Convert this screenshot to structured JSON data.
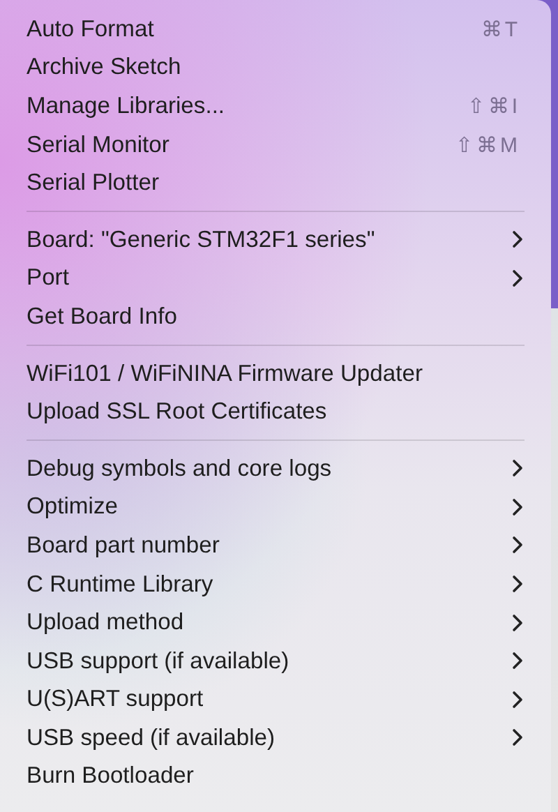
{
  "menu": {
    "sections": [
      {
        "items": [
          {
            "label": "Auto Format",
            "shortcut": "⌘T",
            "submenu": false
          },
          {
            "label": "Archive Sketch",
            "submenu": false
          },
          {
            "label": "Manage Libraries...",
            "shortcut": "⇧⌘I",
            "submenu": false
          },
          {
            "label": "Serial Monitor",
            "shortcut": "⇧⌘M",
            "submenu": false
          },
          {
            "label": "Serial Plotter",
            "submenu": false
          }
        ]
      },
      {
        "items": [
          {
            "label": "Board: \"Generic STM32F1 series\"",
            "submenu": true
          },
          {
            "label": "Port",
            "submenu": true
          },
          {
            "label": "Get Board Info",
            "submenu": false
          }
        ]
      },
      {
        "items": [
          {
            "label": "WiFi101 / WiFiNINA Firmware Updater",
            "submenu": false
          },
          {
            "label": "Upload SSL Root Certificates",
            "submenu": false
          }
        ]
      },
      {
        "items": [
          {
            "label": "Debug symbols and core logs",
            "submenu": true
          },
          {
            "label": "Optimize",
            "submenu": true
          },
          {
            "label": "Board part number",
            "submenu": true
          },
          {
            "label": "C Runtime Library",
            "submenu": true
          },
          {
            "label": "Upload method",
            "submenu": true
          },
          {
            "label": "USB support (if available)",
            "submenu": true
          },
          {
            "label": "U(S)ART support",
            "submenu": true
          },
          {
            "label": "USB speed (if available)",
            "submenu": true
          },
          {
            "label": "Burn Bootloader",
            "submenu": false
          }
        ]
      }
    ]
  }
}
